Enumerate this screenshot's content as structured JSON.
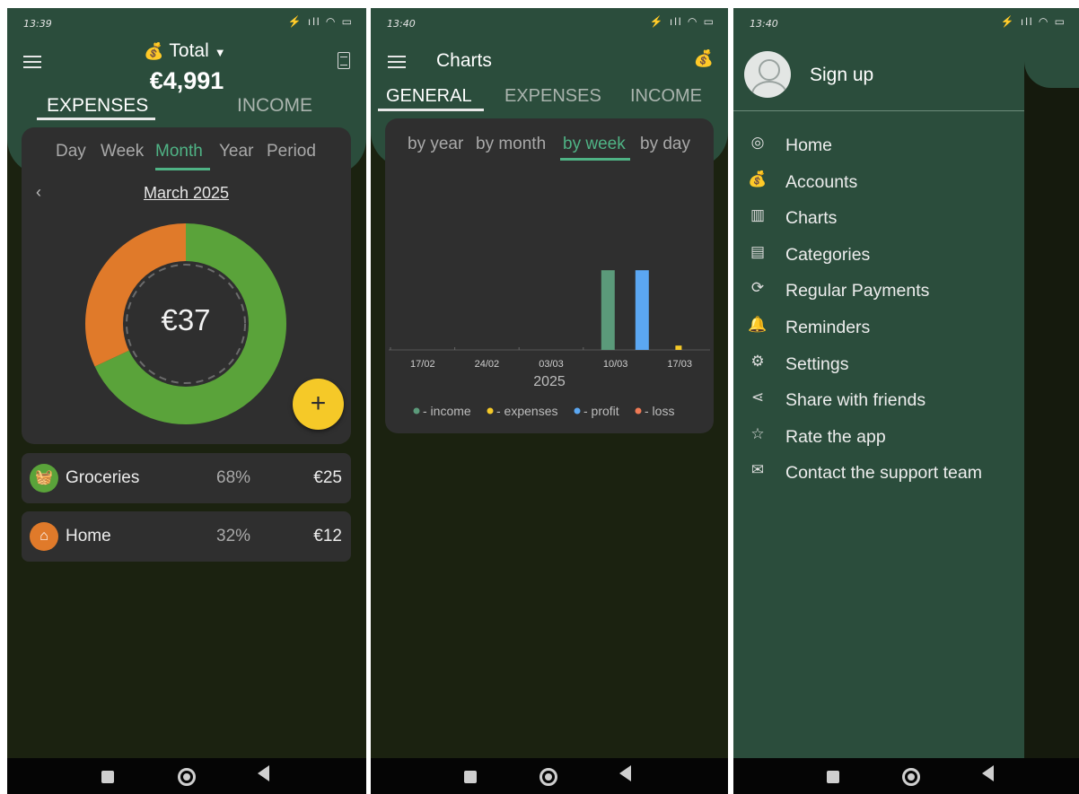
{
  "colors": {
    "header_green": "#2b4d3c",
    "background": "#1b2210",
    "card": "#2f2f2f",
    "accent": "#4fb385",
    "fab": "#f5c928",
    "orange": "#e07a2a",
    "green": "#5aa33a",
    "income": "#5b9a7a",
    "expenses": "#f5c928",
    "profit": "#5ba7f2",
    "loss": "#f07a55"
  },
  "panel1": {
    "status": {
      "time": "13:39"
    },
    "header": {
      "title": "Total",
      "total": "€4,991"
    },
    "tabs": [
      {
        "label": "EXPENSES"
      },
      {
        "label": "INCOME"
      }
    ],
    "periods": [
      {
        "label": "Day"
      },
      {
        "label": "Week"
      },
      {
        "label": "Month"
      },
      {
        "label": "Year"
      },
      {
        "label": "Period"
      }
    ],
    "month": "March 2025",
    "center_amount": "€37",
    "fab_label": "+",
    "categories": [
      {
        "name": "Groceries",
        "percent": "68%",
        "amount": "€25",
        "share": 0.68,
        "icon": "basket-icon",
        "color": "#5aa33a"
      },
      {
        "name": "Home",
        "percent": "32%",
        "amount": "€12",
        "share": 0.32,
        "icon": "house-icon",
        "color": "#e07a2a"
      }
    ]
  },
  "panel2": {
    "status": {
      "time": "13:40"
    },
    "title": "Charts",
    "tabs": [
      {
        "label": "GENERAL"
      },
      {
        "label": "EXPENSES"
      },
      {
        "label": "INCOME"
      }
    ],
    "granularity": [
      {
        "label": "by year"
      },
      {
        "label": "by month"
      },
      {
        "label": "by week"
      },
      {
        "label": "by day"
      }
    ]
  },
  "chart_data": {
    "type": "bar",
    "categories": [
      "17/02",
      "24/02",
      "03/03",
      "10/03",
      "17/03"
    ],
    "xlabel": "2025",
    "grid": false,
    "series": [
      {
        "name": "income",
        "color": "#5b9a7a",
        "values": [
          0,
          0,
          0,
          37,
          0
        ]
      },
      {
        "name": "expenses",
        "color": "#f5c928",
        "values": [
          0,
          0,
          0,
          0,
          2
        ]
      },
      {
        "name": "profit",
        "color": "#5ba7f2",
        "values": [
          0,
          0,
          0,
          37,
          0
        ]
      },
      {
        "name": "loss",
        "color": "#f07a55",
        "values": [
          0,
          0,
          0,
          0,
          0
        ]
      }
    ],
    "legend": [
      "- income",
      "- expenses",
      "- profit",
      "- loss"
    ],
    "legend_position": "bottom",
    "ylim": [
      0,
      45
    ]
  },
  "panel3": {
    "status": {
      "time": "13:40"
    },
    "signup": "Sign up",
    "menu": [
      {
        "label": "Home",
        "icon": "home-icon",
        "glyph": "◎"
      },
      {
        "label": "Accounts",
        "icon": "money-bag-icon",
        "glyph": "💰"
      },
      {
        "label": "Charts",
        "icon": "bar-chart-icon",
        "glyph": "▥"
      },
      {
        "label": "Categories",
        "icon": "categories-icon",
        "glyph": "▤"
      },
      {
        "label": "Regular Payments",
        "icon": "recurring-payment-icon",
        "glyph": "⟳"
      },
      {
        "label": "Reminders",
        "icon": "bell-icon",
        "glyph": "🔔"
      },
      {
        "label": "Settings",
        "icon": "gear-icon",
        "glyph": "⚙"
      },
      {
        "label": "Share with friends",
        "icon": "share-icon",
        "glyph": "⋖"
      },
      {
        "label": "Rate the app",
        "icon": "star-icon",
        "glyph": "☆"
      },
      {
        "label": "Contact the support team",
        "icon": "mail-icon",
        "glyph": "✉"
      }
    ]
  }
}
